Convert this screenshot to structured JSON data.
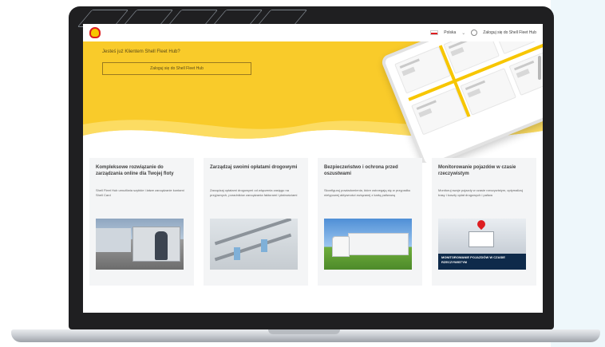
{
  "header": {
    "country": "Polska",
    "login_link": "Zaloguj się do Shell Fleet Hub"
  },
  "hero": {
    "question": "Jesteś już Klientem Shell Fleet Hub?",
    "login_button": "Zaloguj się do Shell Fleet Hub"
  },
  "cards": [
    {
      "title": "Kompleksowe rozwiązanie do zarządzania online dla Twojej floty",
      "desc": "Shell Fleet Hub umożliwia szybkie i łatwe zarządzanie kontami Shell Card"
    },
    {
      "title": "Zarządzaj swoimi opłatami drogowymi",
      "desc": "Zarządzaj opłatami drogowymi od włączenia zasięgu na przyjaznych, poradników zarządzania fakturami i płatnościami"
    },
    {
      "title": "Bezpieczeństwo i ochrona przed oszustwami",
      "desc": "Skonfiguruj powiadomienia, które ostrzegają się w przypadku nietypowej aktywności związanej z kartą paliwową"
    },
    {
      "title": "Monitorowanie pojazdów w czasie rzeczywistym",
      "desc": "Monitoruj swoje pojazdy w czasie rzeczywistym, optymalizuj trasy i koszty opłat drogowych i paliwa",
      "image_caption": "MONITOROWANIE POJAZDÓW W CZASIE RZECZYWISTYM"
    }
  ],
  "colors": {
    "brand_yellow": "#f9cb2a",
    "brand_red": "#dd1d21"
  }
}
